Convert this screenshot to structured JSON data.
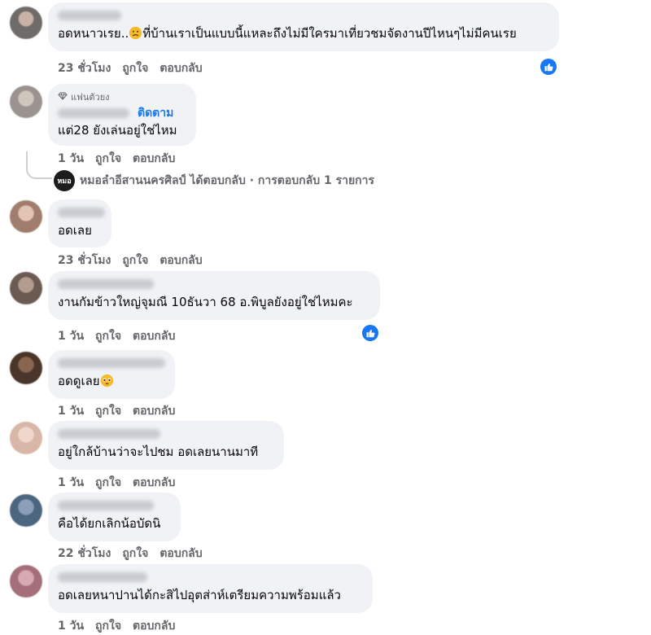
{
  "actions": {
    "like": "ถูกใจ",
    "reply": "ตอบกลับ"
  },
  "comments": [
    {
      "text": "อดหนาวเรย..",
      "text_after": "ที่บ้านเราเป็นแบบนี้แหละถึงไม่มีใครมาเที่ยวชมจัดงานปีไหนๆไม่มีคนเรย",
      "time": "23 ชั่วโมง",
      "liked": true
    },
    {
      "badge": "แฟนตัวยง",
      "follow": "ติดตาม",
      "text": "แต่28 ยังเล่นอยู่ใช่ไหม",
      "time": "1 วัน"
    },
    {
      "text": "อดเลย",
      "time": "23 ชั่วโมง"
    },
    {
      "text": "งานกัมข้าวใหญ่จุมณี 10ธันวา 68 อ.พิบูลยังอยู่ใช่ไหมคะ",
      "time": "1 วัน",
      "liked": true
    },
    {
      "text": "อดดูเลย",
      "time": "1 วัน"
    },
    {
      "text": "อยู่ใกล้บ้านว่าจะไปชม อดเลยนานมาที",
      "time": "1 วัน"
    },
    {
      "text": "คือได้ยกเลิกน้อบัดนิ",
      "time": "22 ชั่วโมง"
    },
    {
      "text": "อดเลยหนาปานได้กะสิไปอุตส่าห์เตรียมความพร้อมแล้ว",
      "time": "1 วัน"
    }
  ],
  "reply_summary": {
    "avatar_text": "หมอ",
    "text": "หมอลำอีสานนครศิลป์ ได้ตอบกลับ · การตอบกลับ 1 รายการ"
  },
  "colors": {
    "bubble": "#f0f2f5",
    "accent": "#1877f2",
    "meta": "#65676b"
  },
  "icons": {
    "like": "thumbs-up-icon",
    "badge": "diamond-icon",
    "sad": "sad-face-emoji",
    "pleading": "pleading-face-emoji"
  }
}
